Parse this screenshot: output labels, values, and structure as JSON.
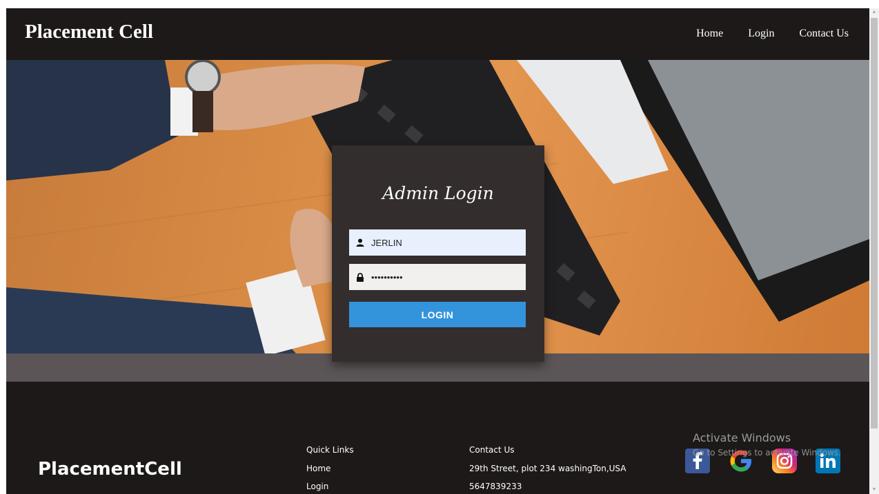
{
  "header": {
    "brand": "Placement Cell",
    "nav": [
      "Home",
      "Login",
      "Contact Us"
    ]
  },
  "login": {
    "title": "Admin Login",
    "username_value": "JERLIN",
    "password_value": "••••••••••",
    "button_label": "LOGIN"
  },
  "footer": {
    "brand": "PlacementCell",
    "quick_links": {
      "heading": "Quick Links",
      "items": [
        "Home",
        "Login"
      ]
    },
    "contact": {
      "heading": "Contact Us",
      "address": "29th Street, plot 234 washingTon,USA",
      "phone": "5647839233"
    },
    "social": [
      "facebook-icon",
      "google-icon",
      "instagram-icon",
      "linkedin-icon"
    ]
  },
  "watermark": {
    "line1": "Activate Windows",
    "line2": "Go to Settings to activate Windows."
  },
  "colors": {
    "header_bg": "#1d1919",
    "card_bg": "#332d2e",
    "button_bg": "#3394dc",
    "band_bg": "#5b5557"
  }
}
